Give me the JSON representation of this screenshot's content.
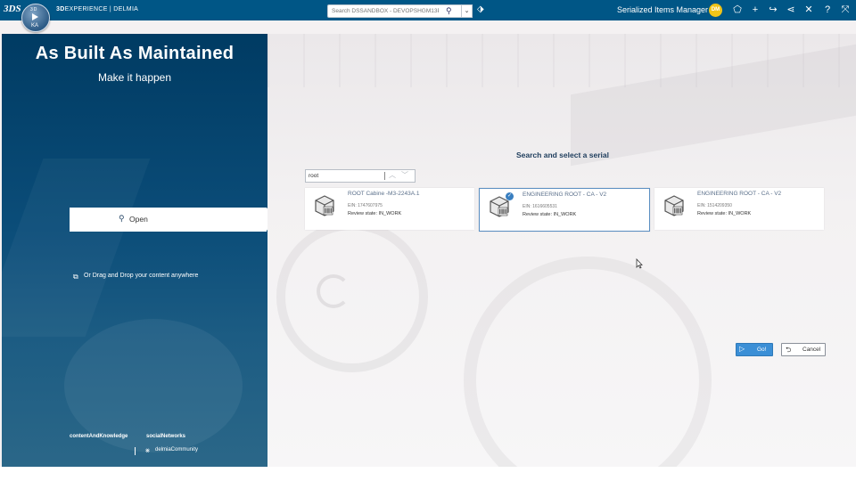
{
  "topbar": {
    "brand_logo": "3DS",
    "brand_prefix": "3D",
    "brand_main": "EXPERIENCE | DELMIA",
    "compass_top": "3D",
    "compass_user": "KA",
    "search_placeholder": "Search DSSANDBOX - DEVOPSHGM13P...",
    "app_name": "Serialized Items Manager",
    "avatar_initials": "DM"
  },
  "left_panel": {
    "title": "As Built As Maintained",
    "subtitle": "Make it happen",
    "open_label": "Open",
    "drag_drop_text": "Or Drag and Drop your content anywhere",
    "footer": {
      "link1": "contentAndKnowledge",
      "link2": "socialNetworks",
      "link3": "delmiaCommunity"
    }
  },
  "selector": {
    "heading": "Search and select a serial",
    "filter_value": "root",
    "cards": [
      {
        "title": "ROOT Cabine -M3-2243A.1",
        "ein": "EIN: 1747607975",
        "state": "Review state: IN_WORK",
        "selected": false
      },
      {
        "title": "ENGINEERING ROOT - CA - V2",
        "ein": "EIN: 1616605531",
        "state": "Review state: IN_WORK",
        "selected": true
      },
      {
        "title": "ENGINEERING ROOT - CA - V2",
        "ein": "EIN: 1514209350",
        "state": "Review state: IN_WORK",
        "selected": false
      }
    ],
    "go_label": "Go!",
    "cancel_label": "Cancel"
  },
  "colors": {
    "topbar": "#005686",
    "left_panel": "#0b4d79",
    "go_button": "#3b8fd6",
    "selected_border": "#5b8fc2",
    "avatar": "#f0c419"
  }
}
